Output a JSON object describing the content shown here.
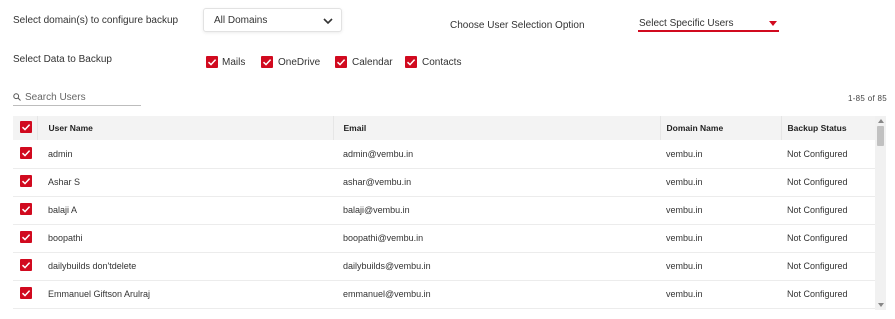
{
  "domain_section": {
    "label": "Select domain(s) to configure backup",
    "selected": "All Domains"
  },
  "user_option": {
    "label": "Choose User Selection Option",
    "selected": "Select Specific Users"
  },
  "data_section": {
    "label": "Select Data to Backup",
    "options": [
      {
        "label": "Mails",
        "checked": true
      },
      {
        "label": "OneDrive",
        "checked": true
      },
      {
        "label": "Calendar",
        "checked": true
      },
      {
        "label": "Contacts",
        "checked": true
      }
    ]
  },
  "search": {
    "placeholder": "Search Users"
  },
  "pagination": {
    "text": "1-85 of 85"
  },
  "table": {
    "headers": [
      "User Name",
      "Email",
      "Domain Name",
      "Backup Status"
    ],
    "rows": [
      {
        "name": "admin",
        "email": "admin@vembu.in",
        "domain": "vembu.in",
        "status": "Not Configured"
      },
      {
        "name": "Ashar S",
        "email": "ashar@vembu.in",
        "domain": "vembu.in",
        "status": "Not Configured"
      },
      {
        "name": "balaji A",
        "email": "balaji@vembu.in",
        "domain": "vembu.in",
        "status": "Not Configured"
      },
      {
        "name": "boopathi",
        "email": "boopathi@vembu.in",
        "domain": "vembu.in",
        "status": "Not Configured"
      },
      {
        "name": "dailybuilds don'tdelete",
        "email": "dailybuilds@vembu.in",
        "domain": "vembu.in",
        "status": "Not Configured"
      },
      {
        "name": "Emmanuel Giftson Arulraj",
        "email": "emmanuel@vembu.in",
        "domain": "vembu.in",
        "status": "Not Configured"
      }
    ]
  },
  "colors": {
    "accent": "#d10a1f",
    "header_bg": "#f3f3f3"
  }
}
